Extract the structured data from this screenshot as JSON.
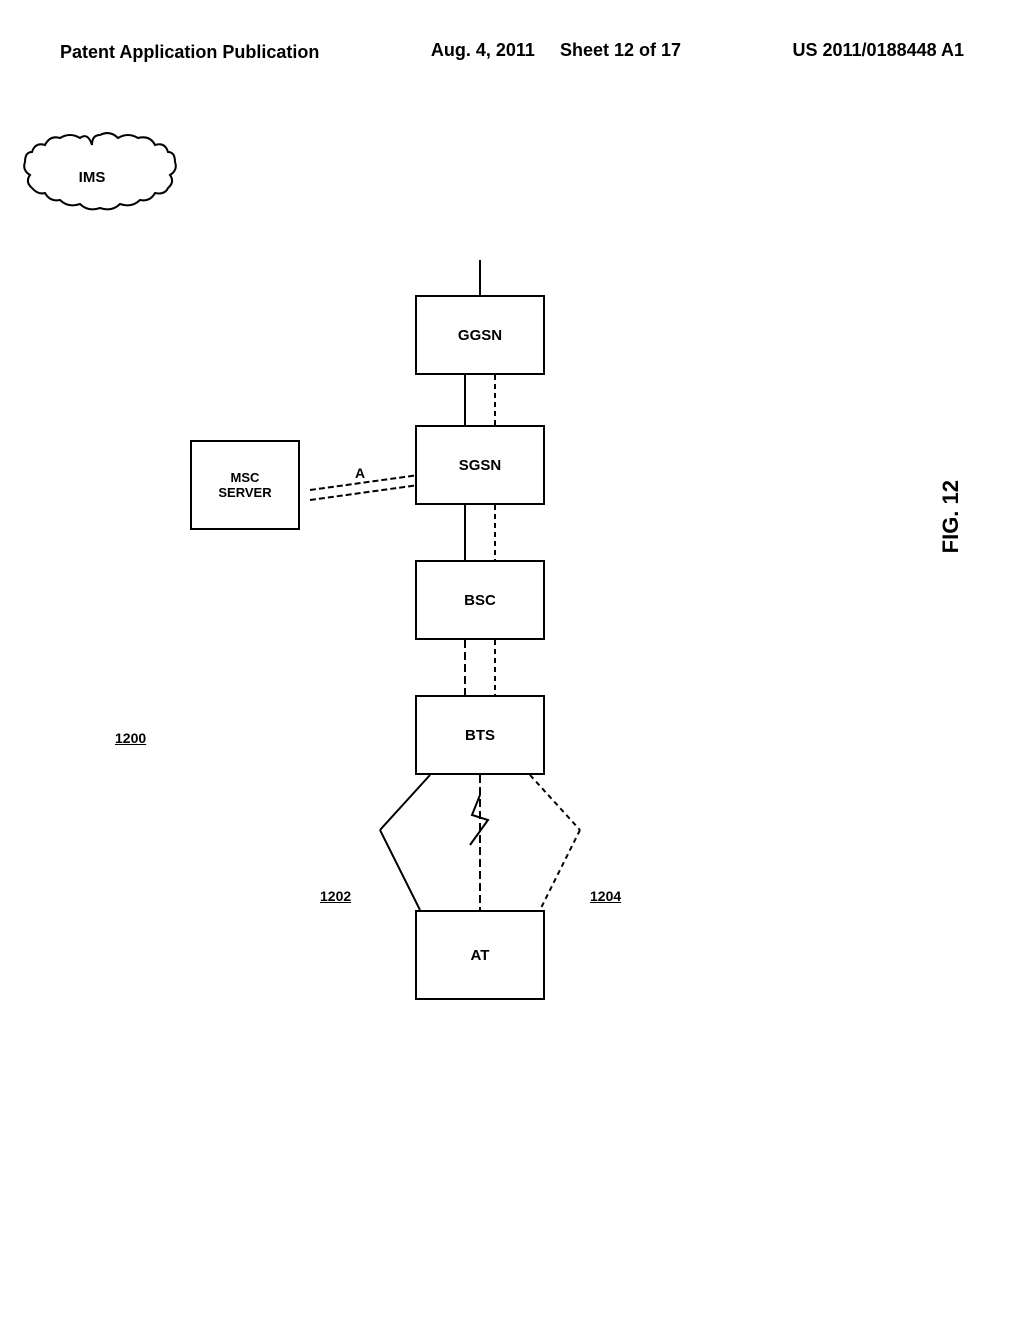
{
  "header": {
    "left_line1": "Patent Application Publication",
    "center": "Aug. 4, 2011",
    "sheet": "Sheet 12 of 17",
    "right": "US 2011/0188448 A1"
  },
  "fig": {
    "label": "FIG. 12"
  },
  "nodes": {
    "ims": "IMS",
    "ggsn": "GGSN",
    "sgsn": "SGSN",
    "bsc": "BSC",
    "bts": "BTS",
    "at": "AT",
    "msc_server": "MSC\nSERVER"
  },
  "refs": {
    "main": "1200",
    "r1202": "1202",
    "r1204": "1204",
    "interface_a": "A"
  }
}
